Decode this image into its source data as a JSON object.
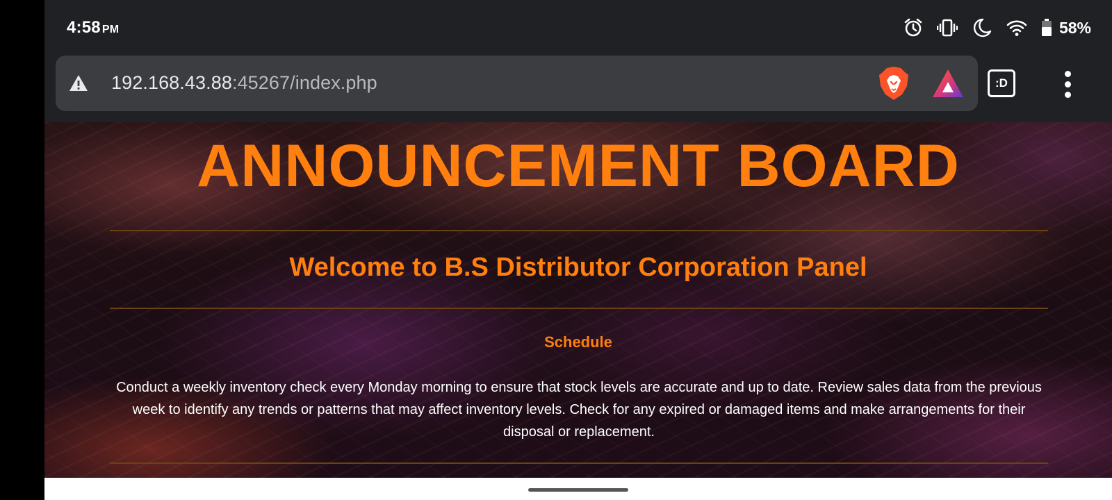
{
  "status_bar": {
    "time": "4:58",
    "ampm": "PM",
    "battery_percent": "58%",
    "icons": [
      "alarm-icon",
      "vibrate-icon",
      "do-not-disturb-moon-icon",
      "wifi-icon",
      "battery-icon"
    ]
  },
  "browser": {
    "url_host": "192.168.43.88",
    "url_rest": ":45267/index.php",
    "security_icon": "warning-triangle-icon",
    "tab_switcher_label": ":D",
    "icons": [
      "brave-lion-icon",
      "brave-rewards-icon",
      "more-vert-icon"
    ]
  },
  "page": {
    "title": "ANNOUNCEMENT BOARD",
    "welcome": "Welcome to B.S Distributor Corporation Panel",
    "schedule_heading": "Schedule",
    "schedule_text": "Conduct a weekly inventory check every Monday morning to ensure that stock levels are accurate and up to date. Review sales data from the previous week to identify any trends or patterns that may affect inventory levels. Check for any expired or damaged items and make arrangements for their disposal or replacement."
  },
  "colors": {
    "accent": "#ff7f0f",
    "rule": "#6a4410",
    "chrome": "#202124",
    "omnibox": "#3c3d40"
  }
}
